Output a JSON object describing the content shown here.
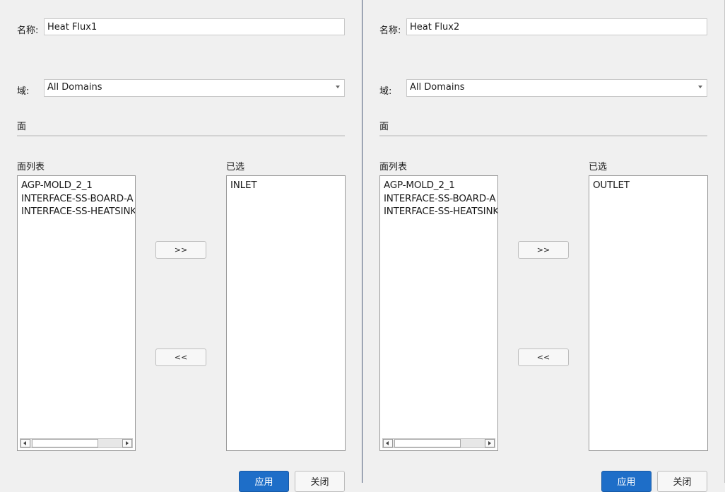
{
  "panels": [
    {
      "name_label": "名称:",
      "name_value": "Heat Flux1",
      "domain_label": "域:",
      "domain_value": "All Domains",
      "section_title": "面",
      "faces_list_label": "面列表",
      "selected_label": "已选",
      "faces_list": [
        "AGP-MOLD_2_1",
        "INTERFACE-SS-BOARD-A",
        "INTERFACE-SS-HEATSINK"
      ],
      "selected_list": [
        "INLET"
      ],
      "add_button": ">>",
      "remove_button": "<<",
      "apply_button": "应用",
      "close_button": "关闭"
    },
    {
      "name_label": "名称:",
      "name_value": "Heat Flux2",
      "domain_label": "域:",
      "domain_value": "All Domains",
      "section_title": "面",
      "faces_list_label": "面列表",
      "selected_label": "已选",
      "faces_list": [
        "AGP-MOLD_2_1",
        "INTERFACE-SS-BOARD-A",
        "INTERFACE-SS-HEATSINK"
      ],
      "selected_list": [
        "OUTLET"
      ],
      "add_button": ">>",
      "remove_button": "<<",
      "apply_button": "应用",
      "close_button": "关闭"
    }
  ],
  "icons": {
    "dropdown": "chevron-down-icon",
    "scroll_left": "arrow-left-icon",
    "scroll_right": "arrow-right-icon"
  },
  "colors": {
    "primary_button": "#1e6ec8",
    "background": "#f0f0f0",
    "divider": "#4a5a78"
  }
}
